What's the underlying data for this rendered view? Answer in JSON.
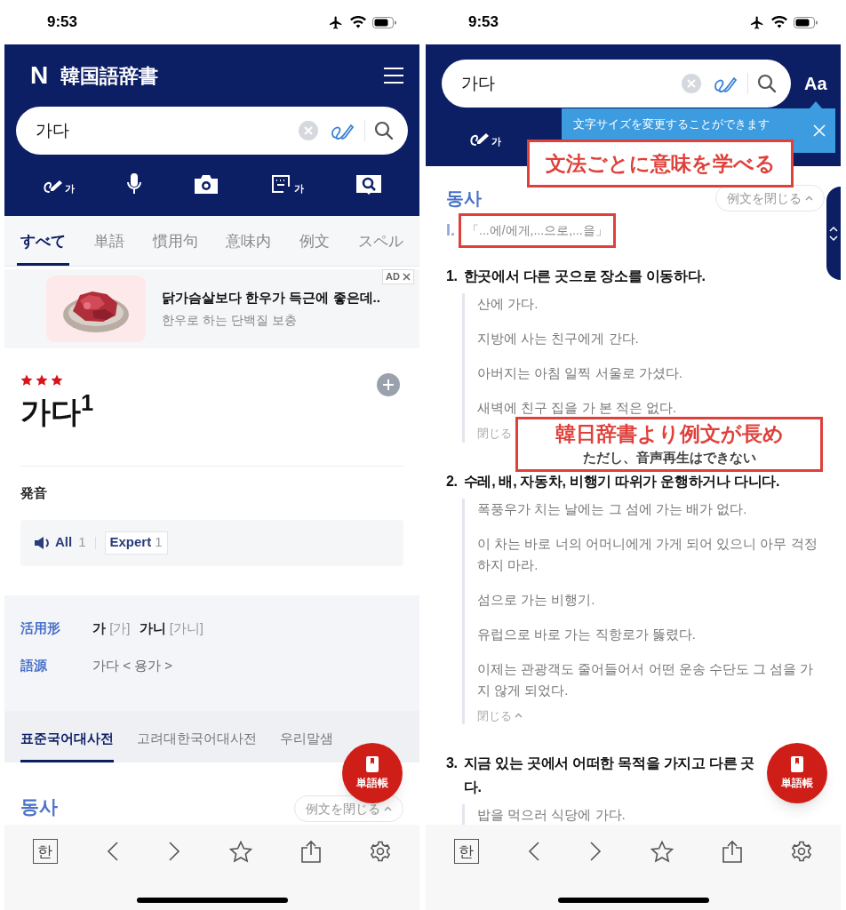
{
  "left_screen": {
    "status_bar": {
      "time": "9:53"
    },
    "header": {
      "logo": "N",
      "title": "韓国語辞書"
    },
    "search": {
      "value": "가다"
    },
    "input_tools": [
      {
        "kind": "handwriting",
        "label": "가"
      },
      {
        "kind": "voice"
      },
      {
        "kind": "camera"
      },
      {
        "kind": "keyboard",
        "label": "가"
      },
      {
        "kind": "book"
      }
    ],
    "tabs": [
      {
        "label": "すべて",
        "selected": true
      },
      {
        "label": "単語",
        "selected": false
      },
      {
        "label": "慣用句",
        "selected": false
      },
      {
        "label": "意味内",
        "selected": false
      },
      {
        "label": "例文",
        "selected": false
      },
      {
        "label": "スペル",
        "selected": false
      }
    ],
    "ad": {
      "badge": "AD",
      "title": "닭가슴살보다 한우가 득근에 좋은데..",
      "subtitle": "한우로 하는 단백질 보충"
    },
    "entry": {
      "stars": 3,
      "headword": "가다$^{1}$"
    },
    "pronunciation": {
      "label": "発音",
      "all_label": "All",
      "all_count": "1",
      "expert_label": "Expert",
      "expert_count": "1"
    },
    "info_rows": [
      {
        "kind": "forms",
        "label": "活用形",
        "forms": [
          {
            "word": "가",
            "reading": "[가]"
          },
          {
            "word": "가니",
            "reading": "[가니]"
          }
        ]
      },
      {
        "kind": "text",
        "label": "語源",
        "value": "가다 < 용가 >"
      }
    ],
    "dictionary_tabs": [
      {
        "label": "표준국어대사전",
        "selected": true
      },
      {
        "label": "고려대한국어대사전",
        "selected": false
      },
      {
        "label": "우리말샘",
        "selected": false
      }
    ],
    "section": {
      "part_of_speech": "동사",
      "toggle": "例文を閉じる"
    },
    "fab": {
      "label": "単語帳"
    },
    "toolbar": {
      "key": "한"
    }
  },
  "right_screen": {
    "status_bar": {
      "time": "9:53"
    },
    "search": {
      "value": "가다"
    },
    "font_button": "Aa",
    "input_tools": [
      {
        "kind": "handwriting",
        "label": "가"
      }
    ],
    "tooltip": "文字サイズを変更することができます",
    "section": {
      "part_of_speech": "동사",
      "toggle": "例文を閉じる"
    },
    "pattern": {
      "numeral": "I.",
      "text": "「...에/에게,...으로,...을」"
    },
    "senses": [
      {
        "number": "1.",
        "lines": [
          "한곳에서 다른 곳으로 장소를 이동하다."
        ],
        "examples": [
          "산에 가다.",
          "지방에 사는 친구에게 간다.",
          "아버지는 아침 일찍 서울로 가셨다.",
          "새벽에 친구 집을 가 본 적은 없다."
        ],
        "close": "閉じる"
      },
      {
        "number": "2.",
        "lines": [
          "수레, 배, 자동차, 비행기 따위가 운행하거나 다니다."
        ],
        "examples": [
          "폭풍우가 치는 날에는 그 섬에 가는 배가 없다.",
          "이 차는 바로 너의 어머니에게 가게 되어 있으니 아무 걱정 하지 마라.",
          "섬으로 가는 비행기.",
          "유럽으로 바로 가는 직항로가 뚫렸다.",
          "이제는 관광객도 줄어들어서 어떤 운송 수단도 그 섬을 가지 않게 되었다."
        ],
        "close": "閉じる"
      },
      {
        "number": "3.",
        "lines": [
          "지금 있는 곳에서 어떠한 목적을 가지고 다른 곳",
          "다."
        ],
        "examples": [
          "밥을 먹으러 식당에 가다."
        ]
      }
    ],
    "callouts": [
      {
        "title": "文法ごとに意味を学べる"
      },
      {
        "title": "韓日辞書より例文が長め",
        "subtitle": "ただし、音声再生はできない"
      }
    ],
    "fab": {
      "label": "単語帳"
    },
    "toolbar": {
      "key": "한"
    }
  }
}
